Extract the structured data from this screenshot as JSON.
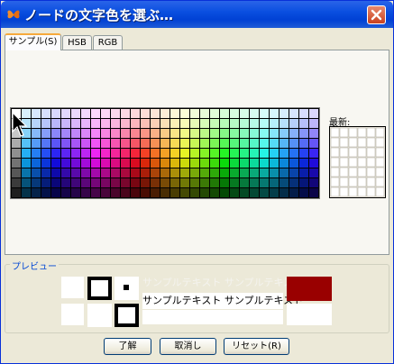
{
  "window": {
    "title": "ノードの文字色を選ぶ…",
    "close_glyph": "✕"
  },
  "tabs": [
    {
      "label": "サンプル(S)",
      "active": true
    },
    {
      "label": "HSB",
      "active": false
    },
    {
      "label": "RGB",
      "active": false
    }
  ],
  "swatches": {
    "recent_label": "最新:"
  },
  "preview": {
    "label": "プレビュー",
    "sample_text_light": "サンプルテキスト サンプルテキスト",
    "sample_text_dark": "サンプルテキスト サンプルテキスト",
    "selected_color": "#990000"
  },
  "buttons": {
    "ok": "了解",
    "cancel": "取消し",
    "reset": "リセット(R)"
  },
  "colors": {
    "title_bar": "#0a4fe0",
    "dialog_bg": "#ece9d8",
    "close_button": "#d2502f"
  }
}
